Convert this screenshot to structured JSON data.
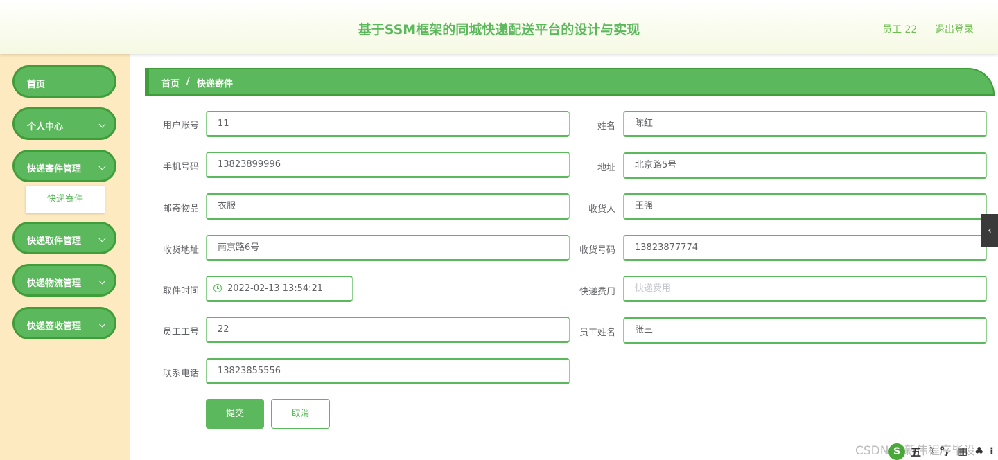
{
  "header": {
    "title": "基于SSM框架的同城快递配送平台的设计与实现",
    "user_label": "员工 22",
    "logout_label": "退出登录"
  },
  "sidebar": {
    "items": [
      {
        "label": "首页",
        "has_chevron": false
      },
      {
        "label": "个人中心",
        "has_chevron": true
      },
      {
        "label": "快递寄件管理",
        "has_chevron": true
      },
      {
        "label": "快递取件管理",
        "has_chevron": true
      },
      {
        "label": "快递物流管理",
        "has_chevron": true
      },
      {
        "label": "快递签收管理",
        "has_chevron": true
      }
    ],
    "submenu": {
      "label": "快递寄件"
    }
  },
  "breadcrumb": {
    "home": "首页",
    "separator": "/",
    "current": "快递寄件"
  },
  "form": {
    "user_account": {
      "label": "用户账号",
      "value": "11"
    },
    "name": {
      "label": "姓名",
      "value": "陈红"
    },
    "phone": {
      "label": "手机号码",
      "value": "13823899996"
    },
    "address": {
      "label": "地址",
      "value": "北京路5号"
    },
    "item": {
      "label": "邮寄物品",
      "value": "衣服"
    },
    "receiver": {
      "label": "收货人",
      "value": "王强"
    },
    "receiver_address": {
      "label": "收货地址",
      "value": "南京路6号"
    },
    "receiver_phone": {
      "label": "收货号码",
      "value": "13823877774"
    },
    "pickup_time": {
      "label": "取件时间",
      "value": "2022-02-13 13:54:21"
    },
    "fee": {
      "label": "快递费用",
      "value": "",
      "placeholder": "快递费用"
    },
    "staff_id": {
      "label": "员工工号",
      "value": "22"
    },
    "staff_name": {
      "label": "员工姓名",
      "value": "张三"
    },
    "contact_phone": {
      "label": "联系电话",
      "value": "13823855556"
    },
    "submit_label": "提交",
    "cancel_label": "取消"
  },
  "overlay": {
    "watermark": "CSDN @新伟程序毕设",
    "tray_items": [
      "五",
      "☽",
      "°,",
      "▦",
      "♣",
      "⁝"
    ]
  },
  "colors": {
    "accent": "#5cb85c",
    "accent_dark": "#3f9e3a",
    "sidebar_bg": "#feeac0"
  }
}
